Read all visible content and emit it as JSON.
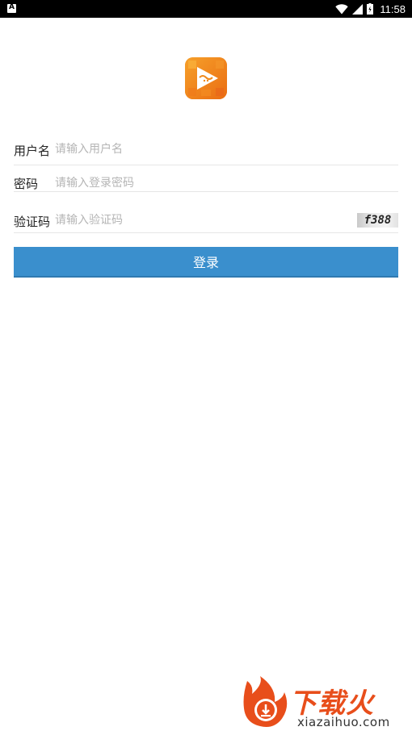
{
  "status_bar": {
    "time": "11:58"
  },
  "login_form": {
    "username": {
      "label": "用户名",
      "placeholder": "请输入用户名"
    },
    "password": {
      "label": "密码",
      "placeholder": "请输入登录密码"
    },
    "captcha": {
      "label": "验证码",
      "placeholder": "请输入验证码",
      "image_text": "f388"
    },
    "submit_label": "登录"
  },
  "colors": {
    "accent": "#3a8fcd",
    "logo_orange": "#f08a1c",
    "watermark_red": "#e84e1b"
  },
  "watermark": {
    "title": "下载火",
    "url": "xiazaihuo.com"
  }
}
